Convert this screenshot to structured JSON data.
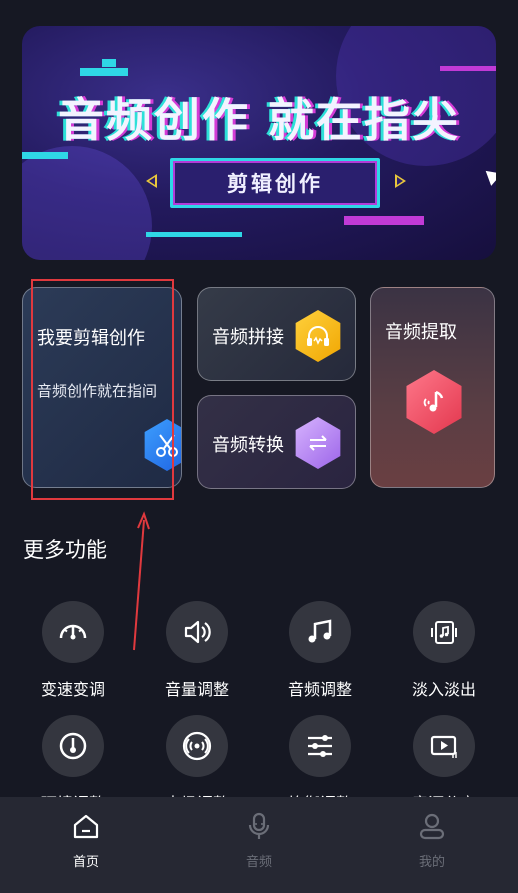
{
  "banner": {
    "title": "音频创作 就在指尖",
    "button_label": "剪辑创作"
  },
  "cards": {
    "edit": {
      "title": "我要剪辑创作",
      "subtitle": "音频创作就在指间",
      "icon": "scissors-icon"
    },
    "splice": {
      "title": "音频拼接",
      "icon": "headphones-icon"
    },
    "convert": {
      "title": "音频转换",
      "icon": "swap-arrows-icon"
    },
    "extract": {
      "title": "音频提取",
      "icon": "music-note-icon"
    }
  },
  "more": {
    "title": "更多功能",
    "tools": [
      {
        "label": "变速变调",
        "icon": "speedometer-icon"
      },
      {
        "label": "音量调整",
        "icon": "speaker-icon"
      },
      {
        "label": "音频调整",
        "icon": "music-note-icon"
      },
      {
        "label": "淡入淡出",
        "icon": "fade-music-icon"
      },
      {
        "label": "环境调整",
        "icon": "circle-target-icon"
      },
      {
        "label": "声场调整",
        "icon": "broadcast-icon"
      },
      {
        "label": "均衡调整",
        "icon": "equalizer-icon"
      },
      {
        "label": "音源分离",
        "icon": "video-play-icon"
      }
    ]
  },
  "nav": {
    "items": [
      {
        "label": "首页",
        "icon": "home-icon",
        "active": true
      },
      {
        "label": "音频",
        "icon": "microphone-icon",
        "active": false
      },
      {
        "label": "我的",
        "icon": "user-icon",
        "active": false
      }
    ]
  },
  "colors": {
    "background": "#161823",
    "nav_background": "#262833",
    "highlight": "#e0393e",
    "accent_cyan": "#2fd7e6",
    "accent_magenta": "#b23cd8"
  }
}
